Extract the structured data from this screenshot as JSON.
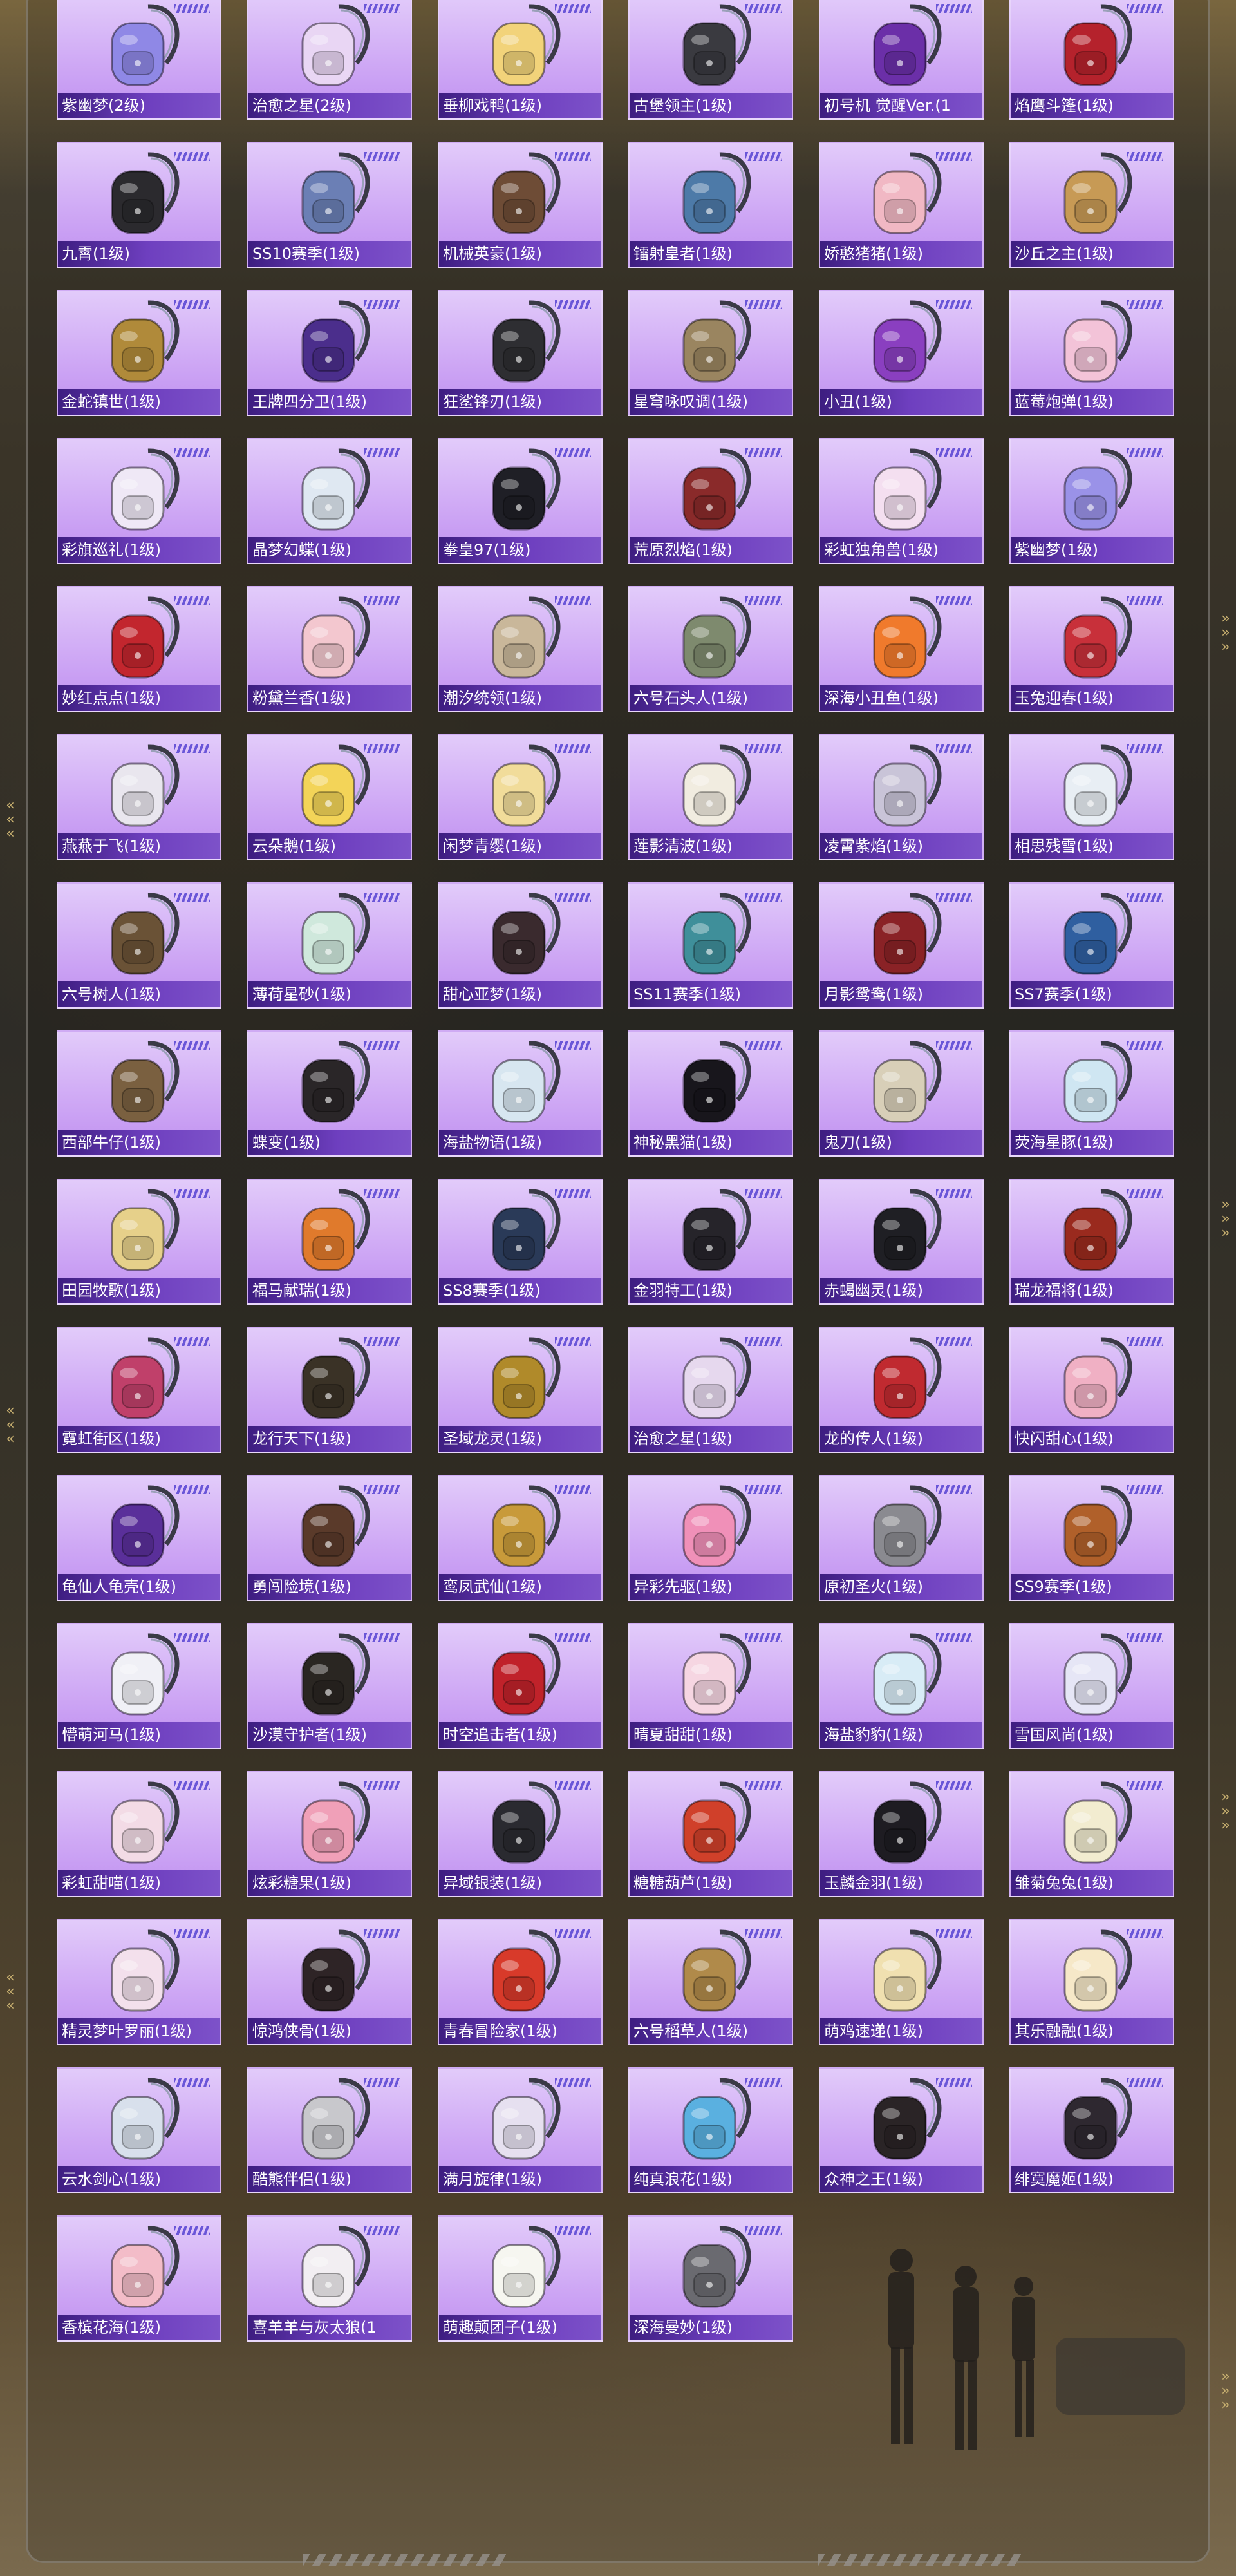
{
  "items": [
    {
      "name": "紫幽梦(2级)",
      "icon": "purple-bunny-backpack-icon",
      "color": "#8f88e6"
    },
    {
      "name": "治愈之星(2级)",
      "icon": "pink-white-backpack-icon",
      "color": "#e9d6f4"
    },
    {
      "name": "垂柳戏鸭(1级)",
      "icon": "yellow-duck-backpack-icon",
      "color": "#f2d37a"
    },
    {
      "name": "古堡领主(1级)",
      "icon": "black-castle-backpack-icon",
      "color": "#3a3a40"
    },
    {
      "name": "初号机 觉醒Ver.(1",
      "icon": "purple-mecha-backpack-icon",
      "color": "#6b2fa8"
    },
    {
      "name": "焰鹰斗篷(1级)",
      "icon": "red-black-eagle-backpack-icon",
      "color": "#b5222c"
    },
    {
      "name": "九霄(1级)",
      "icon": "black-gold-backpack-icon",
      "color": "#2b2a2e"
    },
    {
      "name": "SS10赛季(1级)",
      "icon": "blue-season-backpack-icon",
      "color": "#6b7fb5"
    },
    {
      "name": "机械英豪(1级)",
      "icon": "brown-mech-backpack-icon",
      "color": "#6e4c36"
    },
    {
      "name": "镭射皇者(1级)",
      "icon": "blue-laser-backpack-icon",
      "color": "#4d7aa8"
    },
    {
      "name": "娇憨猪猪(1级)",
      "icon": "pink-pig-backpack-icon",
      "color": "#f1b8c4"
    },
    {
      "name": "沙丘之主(1级)",
      "icon": "tan-dune-backpack-icon",
      "color": "#c79a55"
    },
    {
      "name": "金蛇镇世(1级)",
      "icon": "gold-snake-backpack-icon",
      "color": "#b08a3a"
    },
    {
      "name": "王牌四分卫(1级)",
      "icon": "purple-football-backpack-icon",
      "color": "#4b2e8c"
    },
    {
      "name": "狂鲨锋刃(1级)",
      "icon": "black-shark-backpack-icon",
      "color": "#2e2e32"
    },
    {
      "name": "星穹咏叹调(1级)",
      "icon": "beige-star-backpack-icon",
      "color": "#9a8560"
    },
    {
      "name": "小丑(1级)",
      "icon": "purple-clown-backpack-icon",
      "color": "#8a3fc0"
    },
    {
      "name": "蓝莓炮弹(1级)",
      "icon": "blueberry-cake-backpack-icon",
      "color": "#f3c3d8"
    },
    {
      "name": "彩旗巡礼(1级)",
      "icon": "white-bunny-backpack-icon",
      "color": "#efe8f6"
    },
    {
      "name": "晶梦幻蝶(1级)",
      "icon": "butterfly-backpack-icon",
      "color": "#dfe8f2"
    },
    {
      "name": "拳皇97(1级)",
      "icon": "black-kof-backpack-icon",
      "color": "#1f1f26"
    },
    {
      "name": "荒原烈焰(1级)",
      "icon": "red-flame-backpack-icon",
      "color": "#8a2a2a"
    },
    {
      "name": "彩虹独角兽(1级)",
      "icon": "unicorn-backpack-icon",
      "color": "#f4dff0"
    },
    {
      "name": "紫幽梦(1级)",
      "icon": "purple-bunny-backpack-icon",
      "color": "#9a92e8"
    },
    {
      "name": "妙红点点(1级)",
      "icon": "red-ladybug-backpack-icon",
      "color": "#c2262e"
    },
    {
      "name": "粉黛兰香(1级)",
      "icon": "pink-bunny-backpack-icon",
      "color": "#f3c7cf"
    },
    {
      "name": "潮汐统领(1级)",
      "icon": "tide-armor-backpack-icon",
      "color": "#c9b79a"
    },
    {
      "name": "六号石头人(1级)",
      "icon": "stone-golem-backpack-icon",
      "color": "#7e8a6e"
    },
    {
      "name": "深海小丑鱼(1级)",
      "icon": "clownfish-backpack-icon",
      "color": "#f07a2c"
    },
    {
      "name": "玉兔迎春(1级)",
      "icon": "red-white-rabbit-backpack-icon",
      "color": "#c8303a"
    },
    {
      "name": "燕燕于飞(1级)",
      "icon": "swallow-backpack-icon",
      "color": "#e9e6ee"
    },
    {
      "name": "云朵鹅(1级)",
      "icon": "yellow-flower-backpack-icon",
      "color": "#f3d458"
    },
    {
      "name": "闲梦青缨(1级)",
      "icon": "yellow-bunny-backpack-icon",
      "color": "#f1dc9a"
    },
    {
      "name": "莲影清波(1级)",
      "icon": "lotus-backpack-icon",
      "color": "#f1ece0"
    },
    {
      "name": "凌霄紫焰(1级)",
      "icon": "grey-cat-backpack-icon",
      "color": "#c9c4d8"
    },
    {
      "name": "相思残雪(1级)",
      "icon": "white-cloud-backpack-icon",
      "color": "#e8eef4"
    },
    {
      "name": "六号树人(1级)",
      "icon": "treant-backpack-icon",
      "color": "#6a5236"
    },
    {
      "name": "薄荷星砂(1级)",
      "icon": "mint-backpack-icon",
      "color": "#cfe8dc"
    },
    {
      "name": "甜心亚梦(1级)",
      "icon": "black-red-backpack-icon",
      "color": "#3a2a2e"
    },
    {
      "name": "SS11赛季(1级)",
      "icon": "teal-season-backpack-icon",
      "color": "#3f8f9a"
    },
    {
      "name": "月影鸳鸯(1级)",
      "icon": "red-dot-backpack-icon",
      "color": "#8a2226"
    },
    {
      "name": "SS7赛季(1级)",
      "icon": "blue-orange-backpack-icon",
      "color": "#2f5fa0"
    },
    {
      "name": "西部牛仔(1级)",
      "icon": "cowboy-backpack-icon",
      "color": "#7a6040"
    },
    {
      "name": "蝶变(1级)",
      "icon": "black-leather-backpack-icon",
      "color": "#2a2628"
    },
    {
      "name": "海盐物语(1级)",
      "icon": "light-blue-backpack-icon",
      "color": "#d7e6f0"
    },
    {
      "name": "神秘黑猫(1级)",
      "icon": "black-cat-backpack-icon",
      "color": "#18161c"
    },
    {
      "name": "鬼刀(1级)",
      "icon": "ghost-blade-backpack-icon",
      "color": "#d8cfb8"
    },
    {
      "name": "荧海星豚(1级)",
      "icon": "dolphin-backpack-icon",
      "color": "#cfe6f2"
    },
    {
      "name": "田园牧歌(1级)",
      "icon": "basket-backpack-icon",
      "color": "#e6d08a"
    },
    {
      "name": "福马献瑞(1级)",
      "icon": "orange-horse-backpack-icon",
      "color": "#e07a2c"
    },
    {
      "name": "SS8赛季(1级)",
      "icon": "navy-season-backpack-icon",
      "color": "#2a3a58"
    },
    {
      "name": "金羽特工(1级)",
      "icon": "black-gold-agent-backpack-icon",
      "color": "#26242a"
    },
    {
      "name": "赤蝎幽灵(1级)",
      "icon": "red-x-backpack-icon",
      "color": "#1f1f24"
    },
    {
      "name": "瑞龙福将(1级)",
      "icon": "red-dragon-backpack-icon",
      "color": "#9a2a1e"
    },
    {
      "name": "霓虹街区(1级)",
      "icon": "neon-pink-backpack-icon",
      "color": "#c0406a"
    },
    {
      "name": "龙行天下(1级)",
      "icon": "dragon-gold-backpack-icon",
      "color": "#3a3226"
    },
    {
      "name": "圣域龙灵(1级)",
      "icon": "golden-dragon-mask-backpack-icon",
      "color": "#b08a2a"
    },
    {
      "name": "治愈之星(1级)",
      "icon": "pastel-backpack-icon",
      "color": "#e6d8ee"
    },
    {
      "name": "龙的传人(1级)",
      "icon": "red-white-backpack-icon",
      "color": "#c02a30"
    },
    {
      "name": "快闪甜心(1级)",
      "icon": "pink-camera-backpack-icon",
      "color": "#f0b0c4"
    },
    {
      "name": "龟仙人龟壳(1级)",
      "icon": "purple-shell-backpack-icon",
      "color": "#5a2f9a"
    },
    {
      "name": "勇闯险境(1级)",
      "icon": "brown-leather-backpack-icon",
      "color": "#5a3a2a"
    },
    {
      "name": "鸾凤武仙(1级)",
      "icon": "gold-phoenix-backpack-icon",
      "color": "#c89a3a"
    },
    {
      "name": "异彩先驱(1级)",
      "icon": "pink-green-backpack-icon",
      "color": "#f090b8"
    },
    {
      "name": "原初圣火(1级)",
      "icon": "grey-orange-backpack-icon",
      "color": "#8a8a90"
    },
    {
      "name": "SS9赛季(1级)",
      "icon": "orange-season-backpack-icon",
      "color": "#b0602a"
    },
    {
      "name": "懵萌河马(1级)",
      "icon": "white-hippo-backpack-icon",
      "color": "#f0f0f6"
    },
    {
      "name": "沙漠守护者(1级)",
      "icon": "desert-guardian-backpack-icon",
      "color": "#2a2622"
    },
    {
      "name": "时空追击者(1级)",
      "icon": "red-chaser-backpack-icon",
      "color": "#c0222a"
    },
    {
      "name": "晴夏甜甜(1级)",
      "icon": "pink-bunny-backpack-icon",
      "color": "#f6d6e2"
    },
    {
      "name": "海盐豹豹(1级)",
      "icon": "blue-seal-backpack-icon",
      "color": "#d8ecf6"
    },
    {
      "name": "雪国风尚(1级)",
      "icon": "snow-bunny-backpack-icon",
      "color": "#e6e6f6"
    },
    {
      "name": "彩虹甜喵(1级)",
      "icon": "rainbow-cat-backpack-icon",
      "color": "#f3dbe6"
    },
    {
      "name": "炫彩糖果(1级)",
      "icon": "donut-backpack-icon",
      "color": "#f0a0b8"
    },
    {
      "name": "异域银装(1级)",
      "icon": "black-silver-backpack-icon",
      "color": "#2a2a30"
    },
    {
      "name": "糖糖葫芦(1级)",
      "icon": "candied-fruit-backpack-icon",
      "color": "#d0402a"
    },
    {
      "name": "玉麟金羽(1级)",
      "icon": "black-purse-backpack-icon",
      "color": "#1e1c22"
    },
    {
      "name": "雏菊兔兔(1级)",
      "icon": "daisy-bunny-backpack-icon",
      "color": "#f2ecd0"
    },
    {
      "name": "精灵梦叶罗丽(1级)",
      "icon": "fairy-backpack-icon",
      "color": "#f3e0ec"
    },
    {
      "name": "惊鸿侠骨(1级)",
      "icon": "dark-leather-backpack-icon",
      "color": "#2e2426"
    },
    {
      "name": "青春冒险家(1级)",
      "icon": "red-dino-backpack-icon",
      "color": "#d83a2a"
    },
    {
      "name": "六号稻草人(1级)",
      "icon": "scarecrow-backpack-icon",
      "color": "#b08a4a"
    },
    {
      "name": "萌鸡速递(1级)",
      "icon": "chick-egg-backpack-icon",
      "color": "#f0e0b0"
    },
    {
      "name": "其乐融融(1级)",
      "icon": "cream-bunny-backpack-icon",
      "color": "#f6e8c8"
    },
    {
      "name": "云水剑心(1级)",
      "icon": "sword-charm-backpack-icon",
      "color": "#d8e0ec"
    },
    {
      "name": "酷熊伴侣(1级)",
      "icon": "sunglasses-bear-backpack-icon",
      "color": "#c8c8cc"
    },
    {
      "name": "满月旋律(1级)",
      "icon": "moon-charm-backpack-icon",
      "color": "#e6e0f0"
    },
    {
      "name": "纯真浪花(1级)",
      "icon": "aqua-jar-backpack-icon",
      "color": "#5ab0e0"
    },
    {
      "name": "众神之王(1级)",
      "icon": "black-orange-backpack-icon",
      "color": "#2a2426"
    },
    {
      "name": "绯寞魔姬(1级)",
      "icon": "black-pink-backpack-icon",
      "color": "#2e2830"
    },
    {
      "name": "香槟花海(1级)",
      "icon": "pink-flower-backpack-icon",
      "color": "#f3bcc8"
    },
    {
      "name": "喜羊羊与灰太狼(1",
      "icon": "sheep-backpack-icon",
      "color": "#f2eef2"
    },
    {
      "name": "萌趣颠团子(1级)",
      "icon": "green-duck-backpack-icon",
      "color": "#f6f6f0"
    },
    {
      "name": "深海曼妙(1级)",
      "icon": "diving-tank-backpack-icon",
      "color": "#6a6a70"
    }
  ]
}
